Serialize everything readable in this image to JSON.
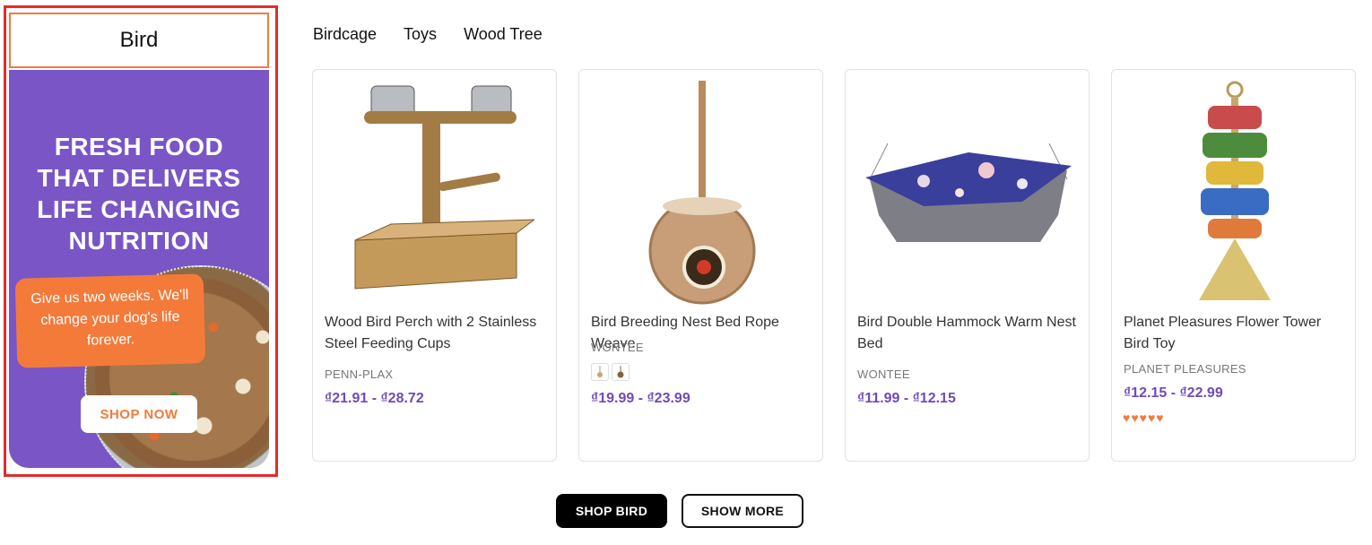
{
  "promo": {
    "category_title": "Bird",
    "headline": "FRESH FOOD THAT DELIVERS LIFE CHANGING NUTRITION",
    "callout": "Give us two weeks. We'll change your dog's life forever.",
    "cta": "SHOP NOW"
  },
  "tabs": [
    {
      "label": "Birdcage"
    },
    {
      "label": "Toys"
    },
    {
      "label": "Wood Tree"
    }
  ],
  "products": [
    {
      "name": "Wood Bird Perch with 2 Stainless Steel Feeding Cups",
      "brand": "PENN-PLAX",
      "price": "₫21.91 - ₫28.72"
    },
    {
      "name": "Bird Breeding Nest Bed Rope Weave",
      "brand": "WONTEE",
      "price": "₫19.99 - ₫23.99"
    },
    {
      "name": "Bird Double Hammock Warm Nest Bed",
      "brand": "WONTEE",
      "price": "₫11.99 - ₫12.15"
    },
    {
      "name": "Planet Pleasures Flower Tower Bird Toy",
      "brand": "PLANET PLEASURES",
      "price": "₫12.15 - ₫22.99",
      "rating_icons": "♥♥♥♥♥"
    }
  ],
  "buttons": {
    "shop": "SHOP BIRD",
    "more": "SHOW MORE"
  },
  "colors": {
    "accent_purple": "#7a55c6",
    "accent_orange": "#f07c3c",
    "price_color": "#6f4bb8",
    "highlight_frame": "#e52a2a"
  }
}
